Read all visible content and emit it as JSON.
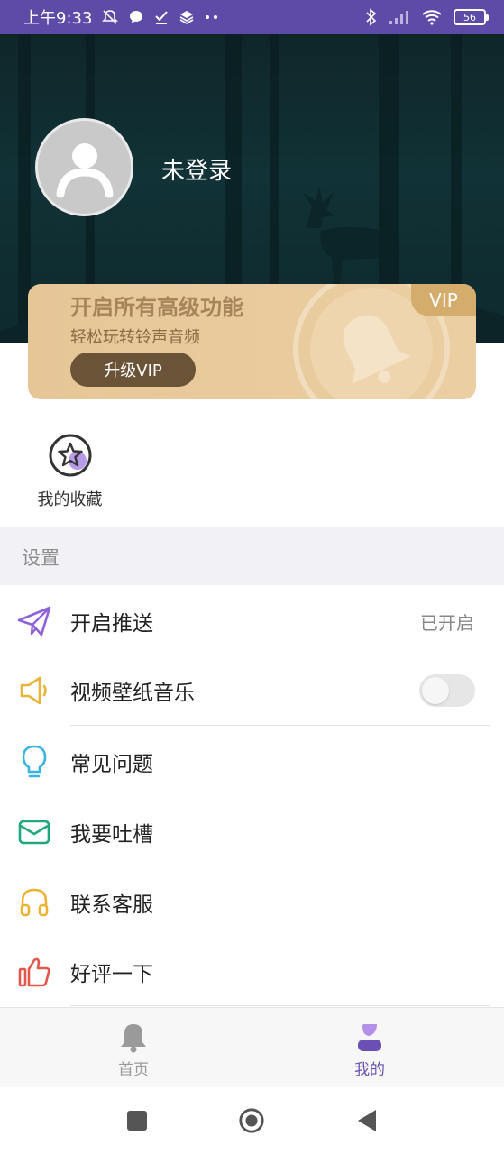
{
  "status_bar": {
    "time": "上午9:33",
    "battery": "56"
  },
  "profile": {
    "login_status": "未登录"
  },
  "vip": {
    "title": "开启所有高级功能",
    "subtitle": "轻松玩转铃声音频",
    "button": "升级VIP",
    "tag": "VIP",
    "colors": {
      "card": "#e6c697",
      "button": "#6b5338",
      "tag": "#d4ac6b"
    }
  },
  "favorites": {
    "label": "我的收藏"
  },
  "settings": {
    "title": "设置",
    "items": [
      {
        "icon": "paper-plane-icon",
        "label": "开启推送",
        "value": "已开启"
      },
      {
        "icon": "speaker-icon",
        "label": "视频壁纸音乐",
        "toggle": false
      },
      {
        "icon": "lightbulb-icon",
        "label": "常见问题"
      },
      {
        "icon": "envelope-icon",
        "label": "我要吐槽"
      },
      {
        "icon": "headphones-icon",
        "label": "联系客服"
      },
      {
        "icon": "thumbs-up-icon",
        "label": "好评一下"
      }
    ]
  },
  "tabbar": {
    "tabs": [
      {
        "icon": "bell-icon",
        "label": "首页",
        "active": false
      },
      {
        "icon": "user-icon",
        "label": "我的",
        "active": true
      }
    ],
    "active_color": "#6a4fb5",
    "inactive_color": "#9a9a9a"
  },
  "navbar": {
    "buttons": [
      "recents-square-icon",
      "home-circle-icon",
      "back-triangle-icon"
    ]
  }
}
